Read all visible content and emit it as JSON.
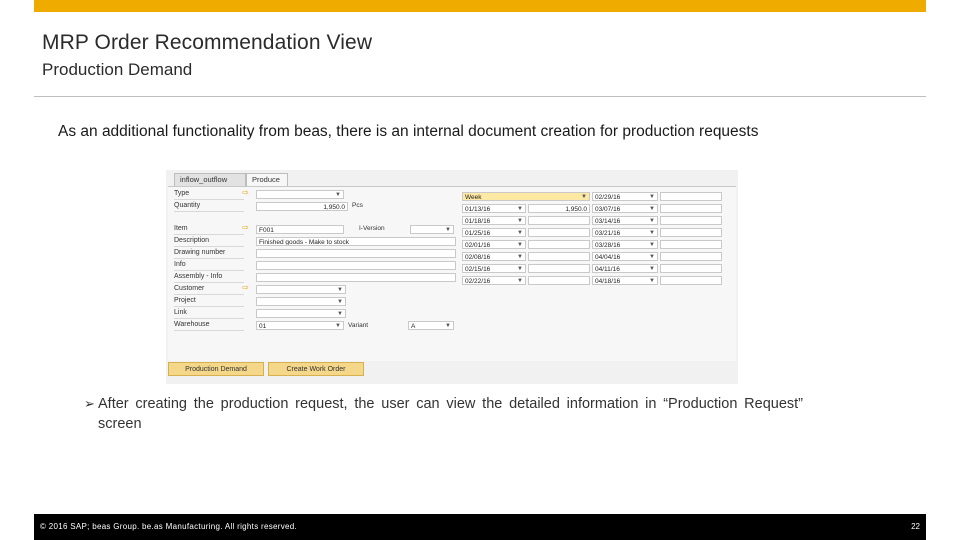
{
  "slide": {
    "title": "MRP Order Recommendation View",
    "subtitle": "Production Demand",
    "intro": "As an additional functionality from beas, there is an internal document creation for production requests",
    "bullet_marker": "➢",
    "bullet": "After creating the production request, the user can view the detailed information in “Production Request” screen",
    "footer_copyright": "© 2016 SAP; beas Group. be.as Manufacturing. All rights reserved.",
    "page_number": "22",
    "accent_color": "#f0ab00"
  },
  "screen": {
    "tabs": [
      "inflow_outflow",
      "Produce"
    ],
    "fields": {
      "type": {
        "label": "Type",
        "value": ""
      },
      "quantity": {
        "label": "Quantity",
        "value": "1,950.0",
        "unit": "Pcs"
      },
      "item": {
        "label": "Item",
        "value": "F001",
        "version_label": "I-Version"
      },
      "description": {
        "label": "Description",
        "value": "Finished goods - Make to stock"
      },
      "drawing_number": {
        "label": "Drawing number",
        "value": ""
      },
      "info": {
        "label": "Info",
        "value": ""
      },
      "assembly_info": {
        "label": "Assembly - Info",
        "value": ""
      },
      "customer": {
        "label": "Customer",
        "value": ""
      },
      "project": {
        "label": "Project",
        "value": ""
      },
      "link": {
        "label": "Link",
        "value": ""
      },
      "warehouse": {
        "label": "Warehouse",
        "value": "01",
        "variant_label": "Variant",
        "variant_value": "A"
      }
    },
    "schedule": {
      "period": "Week",
      "first_quantity": "1,950.0",
      "left_dates": [
        "01/13/16",
        "01/18/16",
        "01/25/16",
        "02/01/16",
        "02/08/16",
        "02/15/16",
        "02/22/16"
      ],
      "right_dates": [
        "02/29/16",
        "03/07/16",
        "03/14/16",
        "03/21/16",
        "03/28/16",
        "04/04/16",
        "04/11/16",
        "04/18/16"
      ]
    },
    "buttons": {
      "production_demand": "Production Demand",
      "create_work_order": "Create Work Order"
    }
  }
}
